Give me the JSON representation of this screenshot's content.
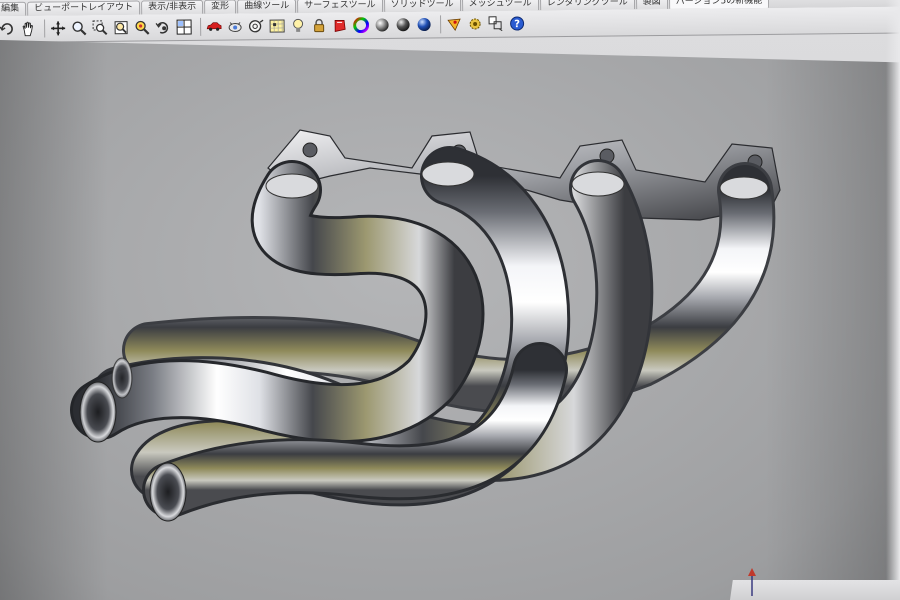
{
  "tabs": [
    {
      "label": "編集"
    },
    {
      "label": "ビューポートレイアウト"
    },
    {
      "label": "表示/非表示"
    },
    {
      "label": "変形"
    },
    {
      "label": "曲線ツール"
    },
    {
      "label": "サーフェスツール"
    },
    {
      "label": "ソリッドツール"
    },
    {
      "label": "メッシュツール"
    },
    {
      "label": "レンダリングツール"
    },
    {
      "label": "製図"
    },
    {
      "label": "バージョン5の新機能"
    }
  ],
  "toolbar_icons": [
    "undo-icon",
    "pan-hand-icon",
    "move-cross-icon",
    "zoom-icon",
    "zoom-window-icon",
    "zoom-extents-icon",
    "zoom-selected-icon",
    "rotate-view-icon",
    "four-viewports-icon",
    "car-icon",
    "named-views-icon",
    "lens-icon",
    "grid-snap-icon",
    "light-bulb-icon",
    "lock-icon",
    "material-paint-icon",
    "color-wheel-icon",
    "shaded-sphere-icon",
    "rendered-sphere-icon",
    "blue-sphere-icon",
    "render-icon",
    "gear-options-icon",
    "layers-icon",
    "help-icon"
  ],
  "colors": {
    "chrome_highlight": "#ffffff",
    "chrome_mid": "#a6a8ae",
    "chrome_dark": "#2e3035",
    "chrome_tint": "#8f8a5a",
    "viewport_bg": "#a8a9ab"
  }
}
